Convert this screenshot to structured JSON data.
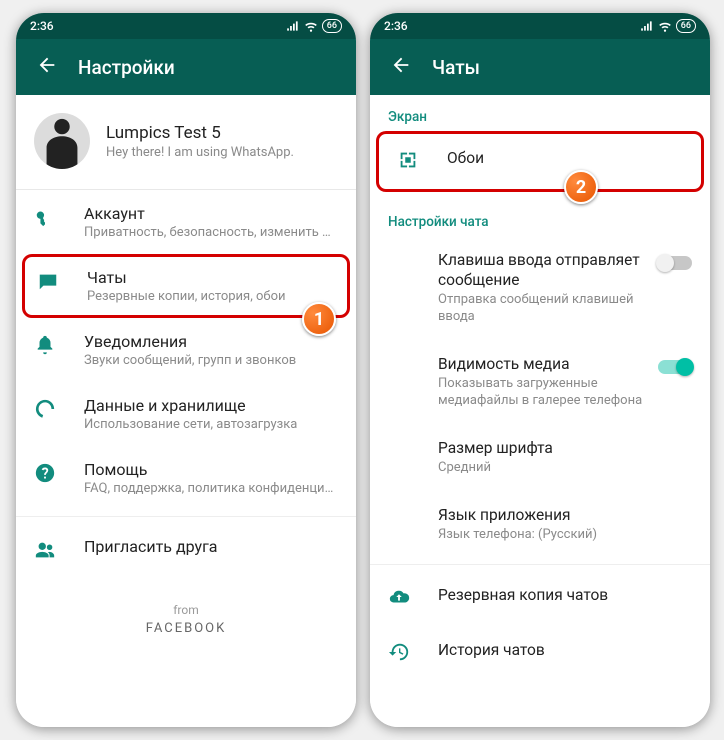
{
  "status": {
    "time": "2:36",
    "battery": "66"
  },
  "left": {
    "appbar_title": "Настройки",
    "profile": {
      "name": "Lumpics Test 5",
      "status": "Hey there! I am using WhatsApp."
    },
    "items": {
      "account": {
        "label": "Аккаунт",
        "sub": "Приватность, безопасность, изменить номер"
      },
      "chats": {
        "label": "Чаты",
        "sub": "Резервные копии, история, обои"
      },
      "notif": {
        "label": "Уведомления",
        "sub": "Звуки сообщений, групп и звонков"
      },
      "data": {
        "label": "Данные и хранилище",
        "sub": "Использование сети, автозагрузка"
      },
      "help": {
        "label": "Помощь",
        "sub": "FAQ, поддержка, политика конфиденциальн..."
      },
      "invite": {
        "label": "Пригласить друга"
      }
    },
    "footer_from": "from",
    "footer_fb": "FACEBOOK"
  },
  "right": {
    "appbar_title": "Чаты",
    "section_screen": "Экран",
    "wallpaper": {
      "label": "Обои"
    },
    "section_chat": "Настройки чата",
    "enterkey": {
      "label": "Клавиша ввода отправляет сообщение",
      "sub": "Отправка сообщений клавишей ввода"
    },
    "media": {
      "label": "Видимость медиа",
      "sub": "Показывать загруженные медиафайлы в галерее телефона"
    },
    "fontsize": {
      "label": "Размер шрифта",
      "sub": "Средний"
    },
    "lang": {
      "label": "Язык приложения",
      "sub": "Язык телефона: (Русский)"
    },
    "backup": {
      "label": "Резервная копия чатов"
    },
    "history": {
      "label": "История чатов"
    }
  },
  "badges": {
    "one": "1",
    "two": "2"
  }
}
